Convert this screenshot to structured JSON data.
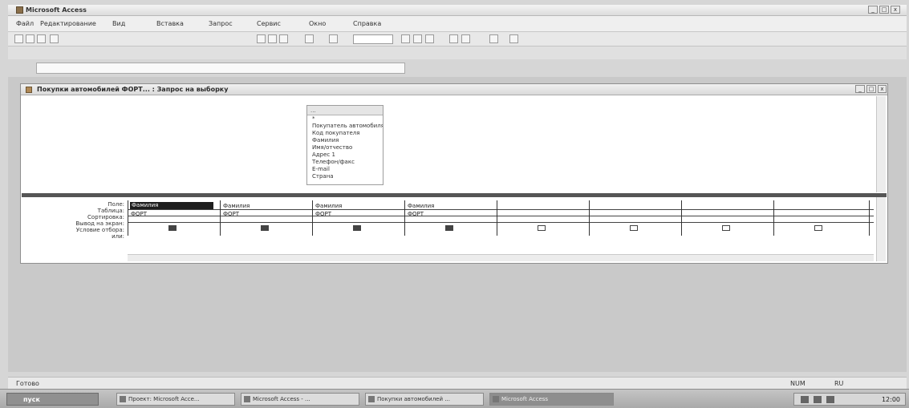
{
  "app": {
    "title": "Microsoft Access",
    "menu": [
      "Файл",
      "Редактирование",
      "Вид",
      "Вставка",
      "Запрос",
      "Сервис",
      "Окно",
      "Справка"
    ]
  },
  "query_window": {
    "title": "Покупки автомобилей ФОРТ... : Запрос на выборку",
    "field_list": {
      "title": "...",
      "items": [
        "*",
        "Покупатель автомобиля",
        "Код покупателя",
        "Фамилия",
        "Имя/отчество",
        "Адрес 1",
        "Телефон/факс",
        "E-mail",
        "Страна"
      ]
    }
  },
  "grid": {
    "row_labels": [
      "Поле:",
      "Таблица:",
      "Сортировка:",
      "Вывод на экран:",
      "Условие отбора:",
      "или:"
    ],
    "columns": [
      {
        "field": "Фамилия",
        "table": "ФОРТ",
        "show": true
      },
      {
        "field": "Фамилия",
        "table": "ФОРТ",
        "show": true
      },
      {
        "field": "Фамилия",
        "table": "ФОРТ",
        "show": true
      },
      {
        "field": "Фамилия",
        "table": "ФОРТ",
        "show": true
      },
      {
        "field": "",
        "table": "",
        "show": false
      },
      {
        "field": "",
        "table": "",
        "show": false
      },
      {
        "field": "",
        "table": "",
        "show": false
      },
      {
        "field": "",
        "table": "",
        "show": false
      }
    ]
  },
  "statusbar": {
    "left": "Готово",
    "right1": "NUM",
    "right2": "RU"
  },
  "taskbar": {
    "start": "пуск",
    "tasks": [
      "Проект: Microsoft Acce...",
      "Microsoft Access - ...",
      "Покупки автомобилей ...",
      "Microsoft Access"
    ],
    "clock": "12:00"
  },
  "colors": {
    "splitter": "#555555",
    "selection": "#1e1e1e"
  }
}
